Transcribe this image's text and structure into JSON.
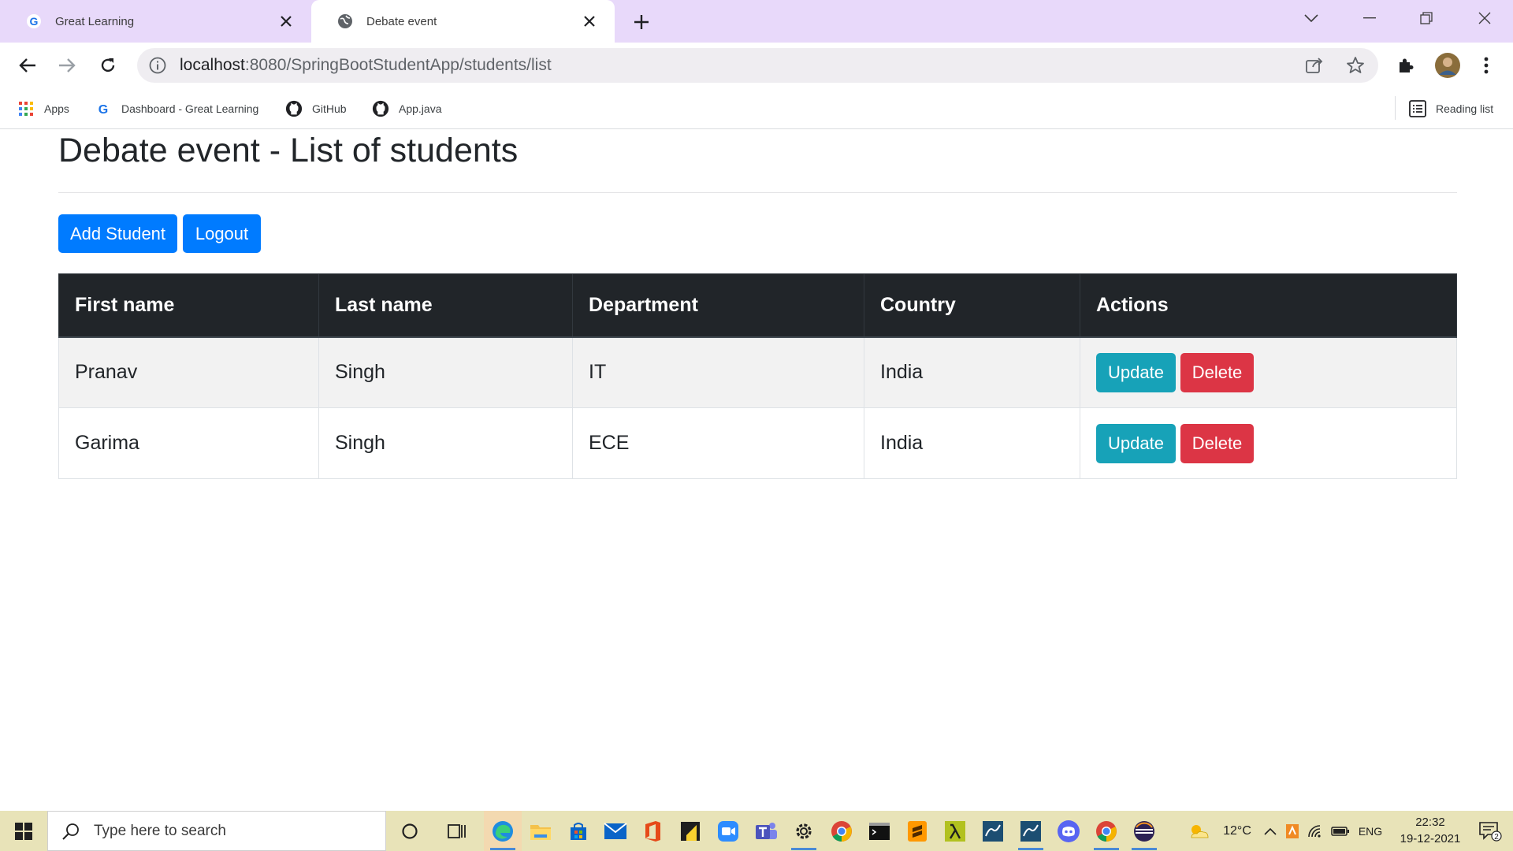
{
  "browser": {
    "tabs": [
      {
        "title": "Great Learning",
        "favicon": "great-learning-g-icon",
        "active": false
      },
      {
        "title": "Debate event",
        "favicon": "globe-icon",
        "active": true
      }
    ],
    "address": {
      "host": "localhost",
      "path": ":8080/SpringBootStudentApp/students/list"
    },
    "bookmarks": [
      {
        "label": "Apps",
        "icon": "apps-grid-icon"
      },
      {
        "label": "Dashboard - Great Learning",
        "icon": "great-learning-g-icon"
      },
      {
        "label": "GitHub",
        "icon": "github-icon"
      },
      {
        "label": "App.java",
        "icon": "github-icon"
      }
    ],
    "reading_list_label": "Reading list"
  },
  "page": {
    "title": "Debate event - List of students",
    "buttons": {
      "add_student": "Add Student",
      "logout": "Logout"
    },
    "table": {
      "headers": [
        "First name",
        "Last name",
        "Department",
        "Country",
        "Actions"
      ],
      "rows": [
        {
          "first_name": "Pranav",
          "last_name": "Singh",
          "department": "IT",
          "country": "India",
          "update_label": "Update",
          "delete_label": "Delete"
        },
        {
          "first_name": "Garima",
          "last_name": "Singh",
          "department": "ECE",
          "country": "India",
          "update_label": "Update",
          "delete_label": "Delete"
        }
      ]
    }
  },
  "taskbar": {
    "search_placeholder": "Type here to search",
    "weather": "12°C",
    "language": "ENG",
    "time": "22:32",
    "date": "19-12-2021",
    "notification_count": "2"
  },
  "colors": {
    "tab_strip": "#e8d9fa",
    "primary": "#007bff",
    "info": "#17a2b8",
    "danger": "#dc3545",
    "table_header": "#212529",
    "taskbar": "#e8e3b8"
  }
}
